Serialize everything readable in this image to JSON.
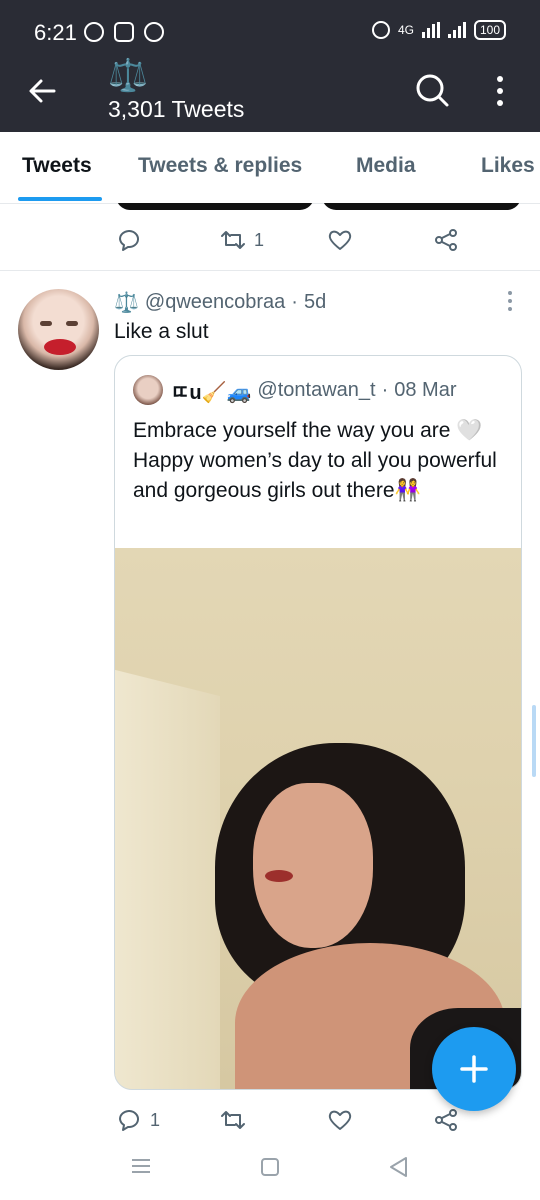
{
  "status_bar": {
    "time": "6:21",
    "network": "4G",
    "battery": "100"
  },
  "header": {
    "emoji": "⚖️",
    "tweet_count": "3,301 Tweets"
  },
  "tabs": [
    {
      "label": "Tweets",
      "active": true
    },
    {
      "label": "Tweets & replies",
      "active": false
    },
    {
      "label": "Media",
      "active": false
    },
    {
      "label": "Likes",
      "active": false
    }
  ],
  "previous_tweet": {
    "retweet_count": "1"
  },
  "tweet": {
    "name_emoji": "⚖️",
    "handle": "@qweencobraa",
    "sep": "·",
    "age": "5d",
    "text": "Like a slut",
    "reply_count": "1",
    "quoted": {
      "display_name": "ㄸu🧹🚙",
      "handle": "@tontawan_t",
      "sep": "·",
      "date": "08 Mar",
      "text": "Embrace yourself the way you are 🤍Happy women’s day to all you powerful and gorgeous girls out there👭"
    }
  },
  "colors": {
    "accent": "#1d9bf0",
    "header_bg": "#2a2c35",
    "muted_text": "#536471"
  }
}
